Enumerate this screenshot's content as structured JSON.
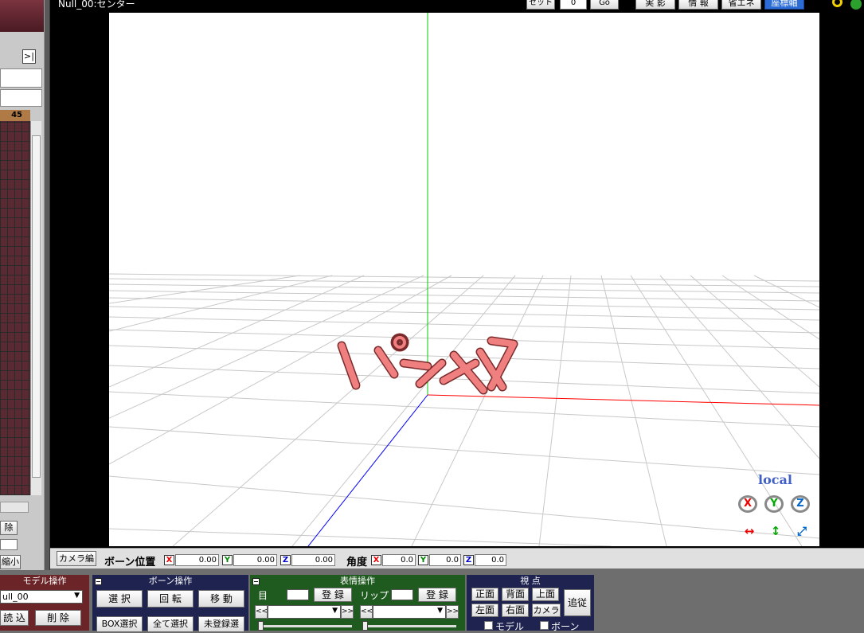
{
  "viewport": {
    "title": "Null_00:センター",
    "set_label": "セット",
    "frame_value": "0",
    "go_label": "Go",
    "toggles": [
      "実 影",
      "情 報",
      "省エネ",
      "座標軸"
    ],
    "local_label": "local",
    "overlay_text": "パッツ"
  },
  "left_panel": {
    "expand_label": ">|",
    "frame_header": "45",
    "delete_label": "除",
    "shrink_label": "縮小"
  },
  "bottom_bar": {
    "camera_edit_label": "カメラ編",
    "bone_pos_label": "ボーン位置",
    "pos": {
      "x": "0.00",
      "y": "0.00",
      "z": "0.00"
    },
    "angle_label": "角度",
    "angle": {
      "x": "0.0",
      "y": "0.0",
      "z": "0.0"
    },
    "axis_x": "X",
    "axis_y": "Y",
    "axis_z": "Z"
  },
  "model_panel": {
    "title": "モデル操作",
    "selected_model": "ull_00",
    "load_label": "読 込",
    "delete_label": "削 除"
  },
  "bone_panel": {
    "title": "ボーン操作",
    "select_label": "選 択",
    "rotate_label": "回 転",
    "move_label": "移 動",
    "box_select_label": "BOX選択",
    "select_all_label": "全て選択",
    "unregistered_label": "未登録選"
  },
  "expression_panel": {
    "title": "表情操作",
    "eye_label": "目",
    "lip_label": "リップ",
    "register_label": "登 録",
    "prev_label": "<<",
    "next_label": ">>"
  },
  "view_panel": {
    "title": "視 点",
    "front_label": "正面",
    "back_label": "背面",
    "top_label": "上面",
    "left_label": "左面",
    "right_label": "右面",
    "camera_label": "カメラ",
    "follow_label": "追従",
    "model_check_label": "モデル",
    "bone_check_label": "ボーン"
  },
  "colors": {
    "x_axis": "#ff0000",
    "y_axis": "#00cc00",
    "z_axis": "#0000ff",
    "grid": "#c8c8c8",
    "text_fill": "#f08080",
    "timeline_bg": "#5a2a33",
    "model_panel_bg": "#6b2428",
    "bone_panel_bg": "#1e2350",
    "expression_panel_bg": "#1f5a1f",
    "view_panel_bg": "#1e2350"
  }
}
